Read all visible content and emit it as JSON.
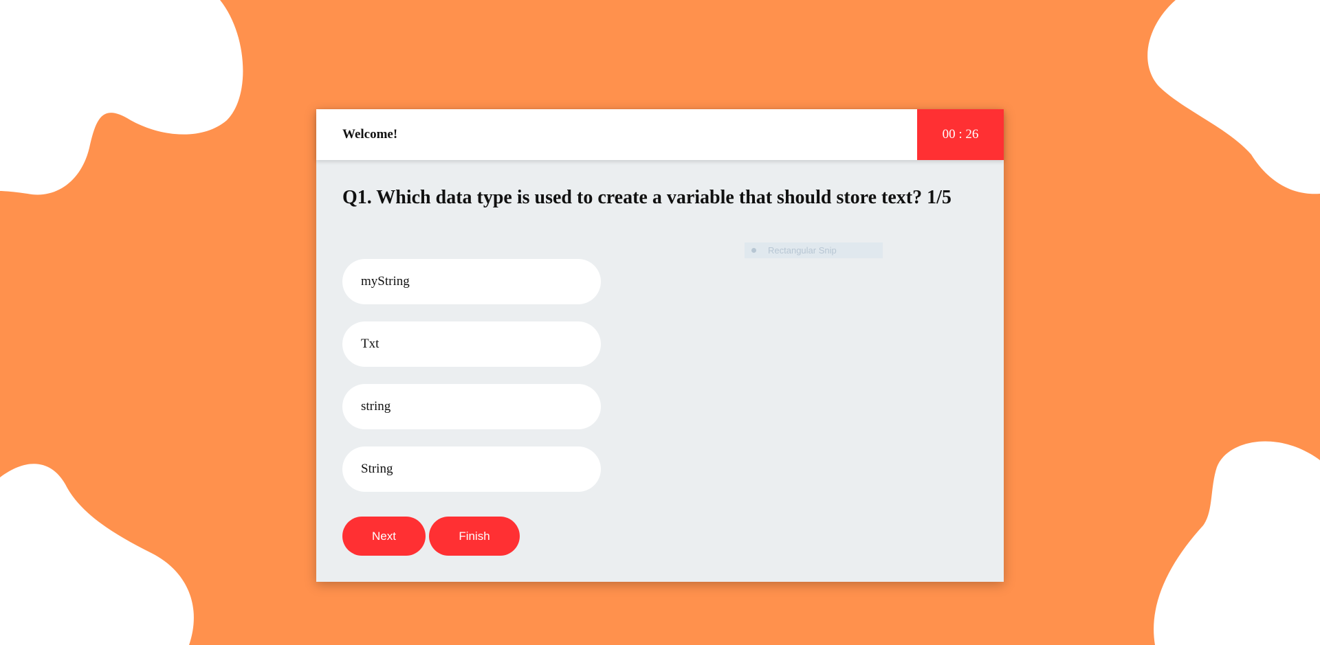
{
  "header": {
    "welcome": "Welcome!",
    "timer": "00 : 26"
  },
  "question": {
    "text": "Q1. Which data type is used to create a variable that should store text? 1/5"
  },
  "options": [
    {
      "label": "myString"
    },
    {
      "label": "Txt"
    },
    {
      "label": "string"
    },
    {
      "label": "String"
    }
  ],
  "buttons": {
    "next": "Next",
    "finish": "Finish"
  },
  "overlay": {
    "snip_label": "Rectangular Snip"
  },
  "colors": {
    "background": "#ff914d",
    "accent": "#ff3033",
    "card": "#ebeef0"
  }
}
